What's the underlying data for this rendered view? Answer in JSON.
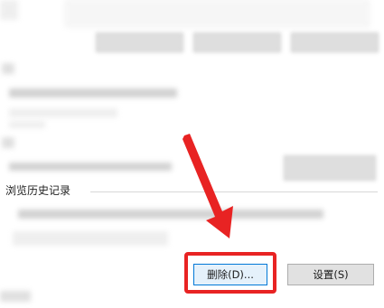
{
  "history_section": {
    "label": "浏览历史记录"
  },
  "buttons": {
    "delete_label": "删除(D)...",
    "settings_label": "设置(S)"
  },
  "annotation": {
    "arrow_color": "#e82323",
    "highlight_color": "#e82323"
  }
}
